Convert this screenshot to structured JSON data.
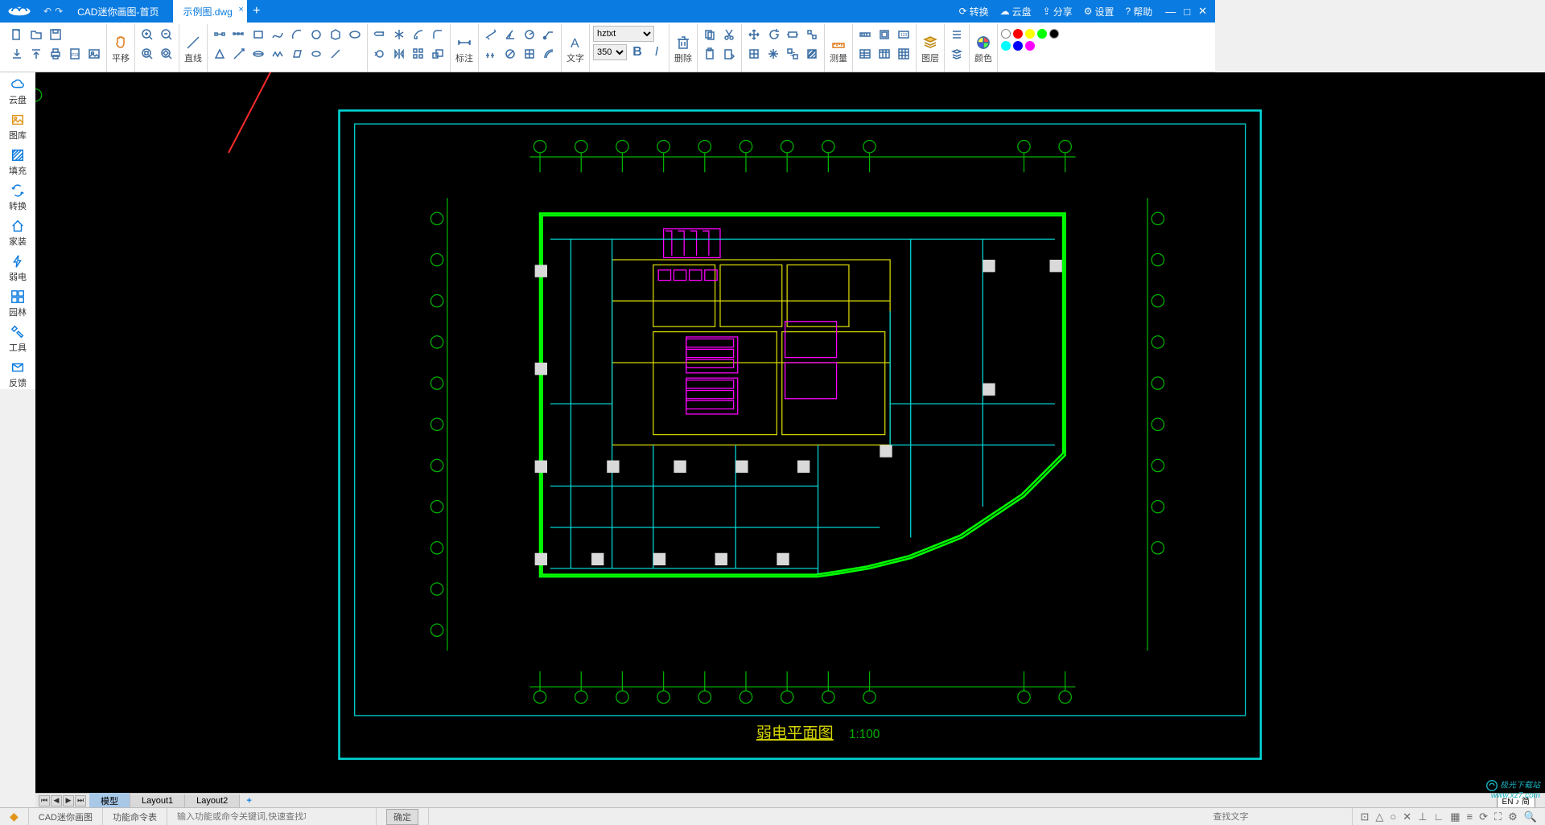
{
  "titlebar": {
    "tab_home": "CAD迷你画图-首页",
    "tab_active": "示例图.dwg",
    "menu": {
      "convert": "转换",
      "cloud": "云盘",
      "share": "分享",
      "settings": "设置",
      "help": "帮助"
    }
  },
  "ribbon": {
    "groups": {
      "pan": "平移",
      "line": "直线",
      "dim": "标注",
      "text": "文字",
      "font_name": "hztxt",
      "font_size": "350",
      "bold": "B",
      "italic": "I",
      "delete": "删除",
      "measure": "测量",
      "layer": "图层",
      "color": "颜色"
    },
    "colors": [
      "#ffffff",
      "#ff0000",
      "#ffff00",
      "#00ff00",
      "#000000",
      "#00ffff",
      "#0000ff",
      "#ff00ff"
    ]
  },
  "sidebar": {
    "items": [
      {
        "label": "云盘"
      },
      {
        "label": "图库"
      },
      {
        "label": "填充"
      },
      {
        "label": "转换"
      },
      {
        "label": "家装"
      },
      {
        "label": "弱电"
      },
      {
        "label": "园林"
      },
      {
        "label": "工具"
      },
      {
        "label": "反馈"
      }
    ]
  },
  "drawing": {
    "title": "弱电平面图",
    "scale": "1:100"
  },
  "bottom_tabs": {
    "model": "模型",
    "layout1": "Layout1",
    "layout2": "Layout2"
  },
  "status": {
    "app_name": "CAD迷你画图",
    "func_list": "功能命令表",
    "cmd_placeholder": "输入功能或命令关键词,快速查找功能",
    "confirm": "确定",
    "search_placeholder": "查找文字",
    "lang": "EN ♪ 简"
  },
  "watermark": {
    "line1": "极光下载站",
    "line2": "www.xz7.com"
  }
}
